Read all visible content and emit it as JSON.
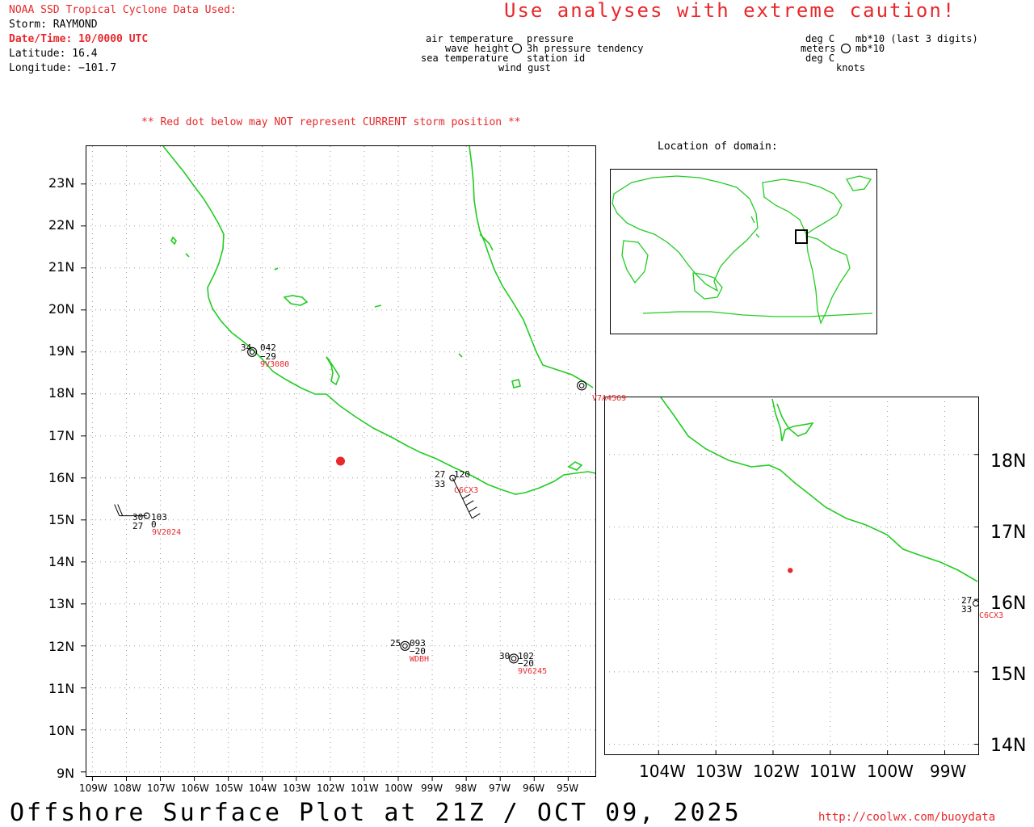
{
  "header": {
    "source_line": "NOAA SSD Tropical Cyclone Data Used:",
    "storm": "Storm: RAYMOND",
    "datetime": "Date/Time: 10/0000 UTC",
    "latitude": "Latitude: 16.4",
    "longitude": "Longitude: −101.7",
    "caution": "Use analyses with extreme caution!"
  },
  "legend": {
    "left_labels": [
      "air temperature",
      "wave height",
      "sea temperature"
    ],
    "right_labels": [
      "pressure",
      "3h pressure tendency",
      "station id"
    ],
    "bottom_label": "wind gust",
    "unit_left": [
      "deg C",
      "meters",
      "deg C"
    ],
    "unit_right": [
      "mb*10 (last 3 digits)",
      "mb*10"
    ],
    "unit_bottom": "knots"
  },
  "notice": "** Red dot below may NOT represent CURRENT storm position **",
  "inset": {
    "title": "Location of domain:"
  },
  "main_map": {
    "lat_ticks": [
      "23N",
      "22N",
      "21N",
      "20N",
      "19N",
      "18N",
      "17N",
      "16N",
      "15N",
      "14N",
      "13N",
      "12N",
      "11N",
      "10N",
      "9N"
    ],
    "lon_ticks": [
      "109W",
      "108W",
      "107W",
      "106W",
      "105W",
      "104W",
      "103W",
      "102W",
      "101W",
      "100W",
      "99W",
      "98W",
      "97W",
      "96W",
      "95W"
    ],
    "storm_position": {
      "lat": 16.4,
      "lon": -101.7,
      "color": "#e8282b"
    },
    "stations": [
      {
        "id": "9V3080",
        "air_temp": "34",
        "pressure": "042",
        "tendency": "−29",
        "lat": 19.0,
        "lon": -104.3
      },
      {
        "id": "V7A4569",
        "lat": 18.2,
        "lon": -94.6
      },
      {
        "id": "C6CX3",
        "air_temp": "27",
        "sea_temp": "33",
        "pressure": "120",
        "lat": 16.0,
        "lon": -98.4
      },
      {
        "id": "9V2024",
        "air_temp": "30",
        "sea_temp": "27",
        "pressure": "103",
        "tendency": "0",
        "lat": 15.1,
        "lon": -107.4
      },
      {
        "id": "WDBH",
        "air_temp": "25",
        "pressure": "093",
        "tendency": "−20",
        "lat": 12.0,
        "lon": -99.8
      },
      {
        "id": "9V6245",
        "air_temp": "30",
        "pressure": "102",
        "tendency": "−20",
        "lat": 11.7,
        "lon": -96.6
      }
    ]
  },
  "zoom_map": {
    "lat_ticks": [
      "18N",
      "17N",
      "16N",
      "15N",
      "14N"
    ],
    "lon_ticks": [
      "104W",
      "103W",
      "102W",
      "101W",
      "100W",
      "99W"
    ],
    "station": {
      "id": "C6CX3",
      "air_temp": "27",
      "sea_temp": "33"
    }
  },
  "footer": {
    "title": "Offshore Surface Plot at 21Z / OCT 09, 2025",
    "url": "http://coolwx.com/buoydata"
  },
  "colors": {
    "coast": "#22cc22",
    "accent": "#e8282b",
    "grid": "#9a9a9a"
  }
}
